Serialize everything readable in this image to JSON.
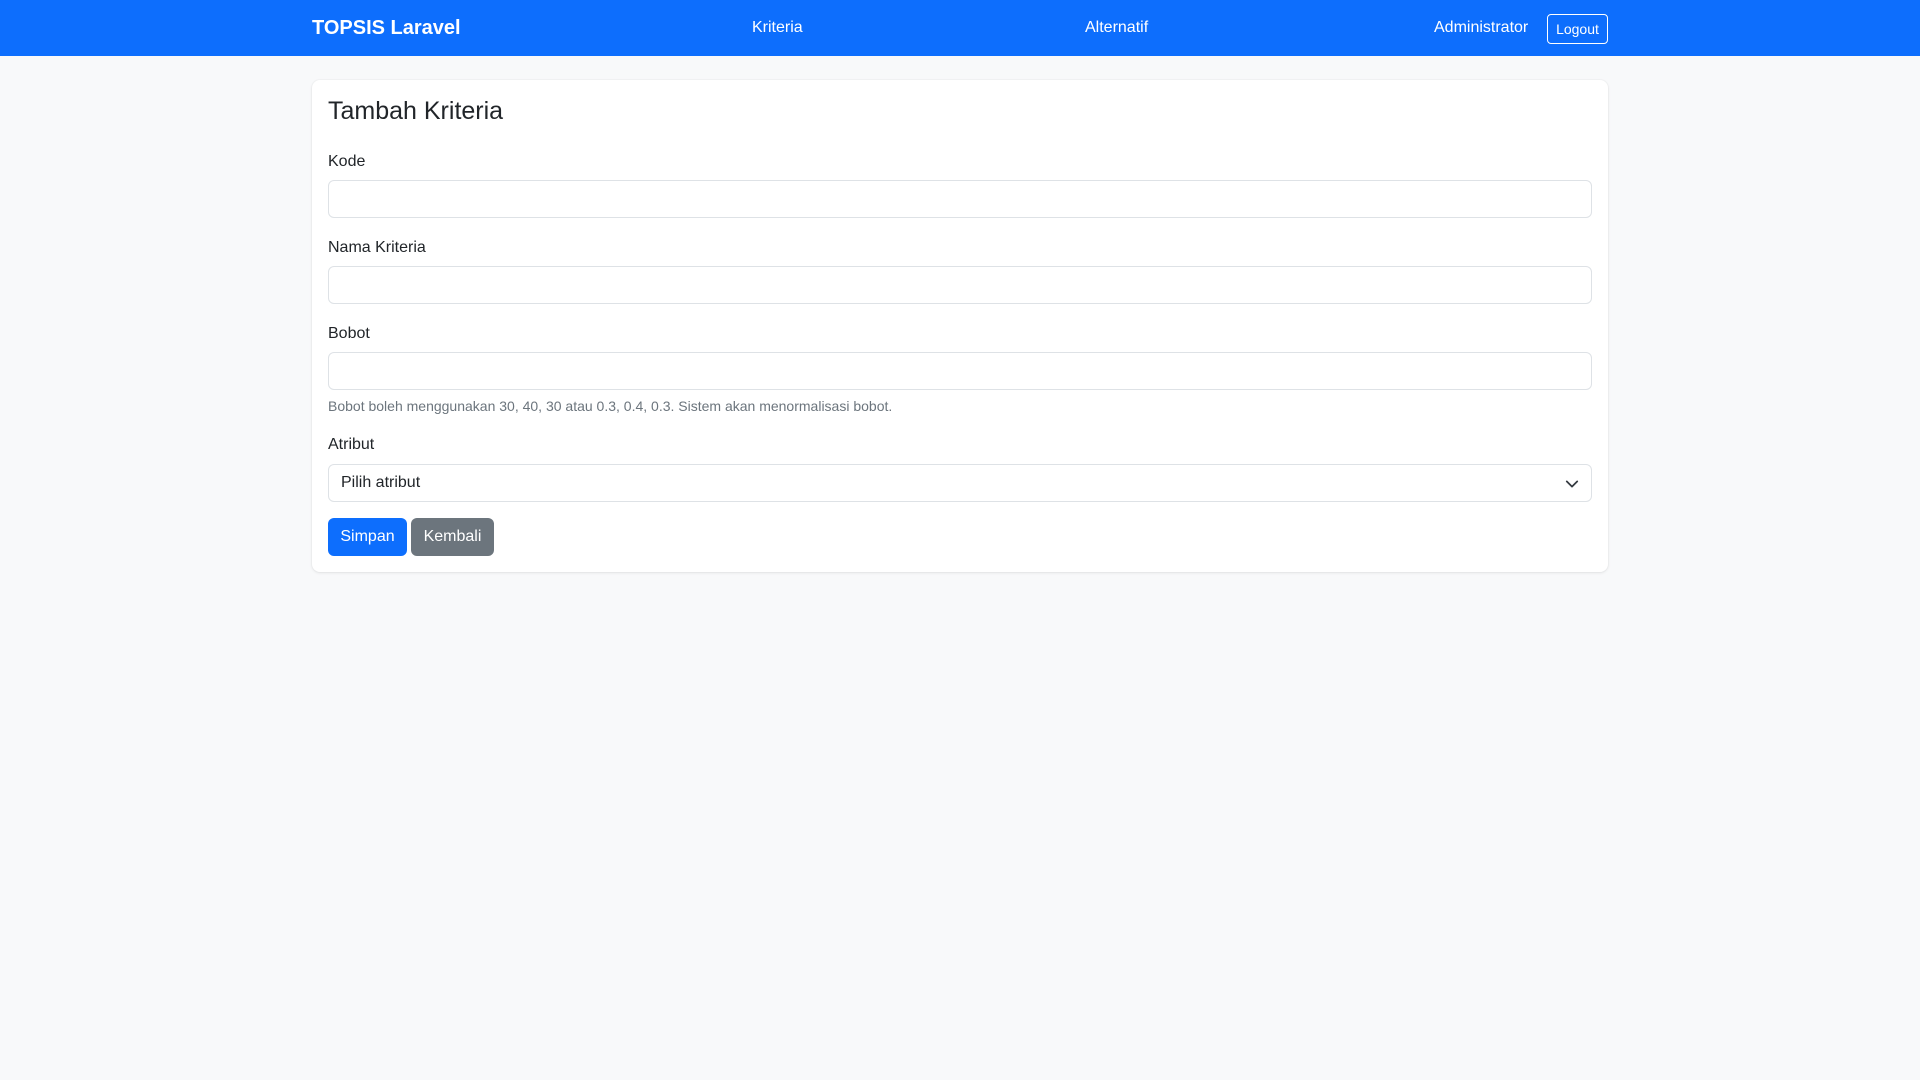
{
  "navbar": {
    "brand": "TOPSIS Laravel",
    "links": [
      {
        "label": "Kriteria"
      },
      {
        "label": "Alternatif"
      }
    ],
    "user": "Administrator",
    "logout_label": "Logout"
  },
  "form": {
    "title": "Tambah Kriteria",
    "fields": {
      "kode": {
        "label": "Kode",
        "value": "",
        "placeholder": ""
      },
      "nama": {
        "label": "Nama Kriteria",
        "value": "",
        "placeholder": ""
      },
      "bobot": {
        "label": "Bobot",
        "value": "",
        "placeholder": ""
      }
    },
    "bobot_help": "Bobot boleh menggunakan 30, 40, 30 atau 0.3, 0.4, 0.3. Sistem akan menormalisasi bobot.",
    "atribut": {
      "label": "Atribut",
      "selected": "Pilih atribut"
    },
    "save_label": "Simpan",
    "back_label": "Kembali"
  },
  "icons": {
    "select_arrow": "chevron-down-icon"
  },
  "colors": {
    "primary": "#0d6efd",
    "secondary": "#6c757d",
    "background": "#f8f9fa"
  }
}
